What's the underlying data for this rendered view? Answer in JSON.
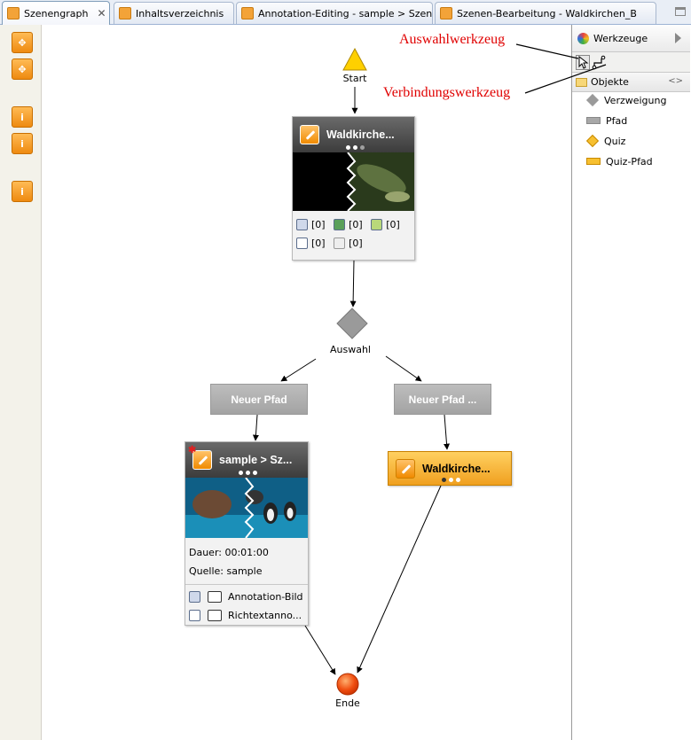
{
  "tabs": [
    {
      "label": "Szenengraph",
      "close": "✕"
    },
    {
      "label": "Inhaltsverzeichnis"
    },
    {
      "label": "Annotation-Editing - sample > Szene"
    },
    {
      "label": "Szenen-Bearbeitung -   Waldkirchen_B"
    }
  ],
  "left_toolbar": [
    {
      "name": "zoom-in-icon"
    },
    {
      "name": "zoom-out-icon"
    },
    {
      "name": "info-plus-icon"
    },
    {
      "name": "info-minus-icon"
    },
    {
      "name": "info-bubble-icon"
    }
  ],
  "palette": {
    "title": "Werkzeuge",
    "objects_title": "Objekte",
    "items": [
      {
        "label": "Verzweigung"
      },
      {
        "label": "Pfad"
      },
      {
        "label": "Quiz"
      },
      {
        "label": "Quiz-Pfad"
      }
    ]
  },
  "annotations": {
    "selection_tool": "Auswahlwerkzeug",
    "connection_tool": "Verbindungswerkzeug"
  },
  "graph": {
    "start_label": "Start",
    "end_label": "Ende",
    "branch_label": "Auswahl",
    "scene1": {
      "title": "Waldkirche...",
      "count_image": "[0]",
      "count_video": "[0]",
      "count_audio": "[0]",
      "count_text": "[0]",
      "count_caption": "[0]"
    },
    "path_left": "Neuer Pfad",
    "path_right": "Neuer Pfad ...",
    "scene2": {
      "title": "sample > Sz...",
      "duration": "Dauer: 00:01:00",
      "source": "Quelle: sample",
      "annotations": [
        "Annotation-Bild",
        "Richtextanno..."
      ]
    },
    "scene3": {
      "title": "Waldkirche..."
    }
  },
  "colors": {
    "accent": "#f0a020",
    "start": "#ffd000",
    "end": "#e84010",
    "annotation": "#e00000"
  }
}
